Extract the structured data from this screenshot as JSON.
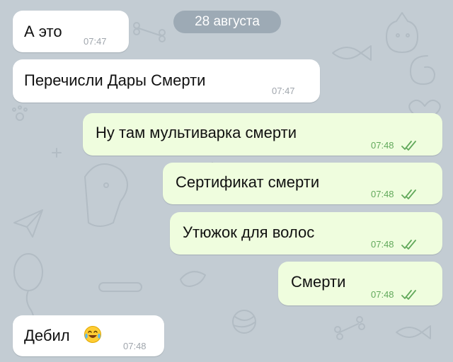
{
  "date_separator": "28 августа",
  "messages": [
    {
      "direction": "in",
      "text": "А это",
      "time": "07:47"
    },
    {
      "direction": "in",
      "text": "Перечисли Дары Смерти",
      "time": "07:47"
    },
    {
      "direction": "out",
      "text": "Ну там мультиварка смерти",
      "time": "07:48",
      "status": "read"
    },
    {
      "direction": "out",
      "text": "Сертификат смерти",
      "time": "07:48",
      "status": "read"
    },
    {
      "direction": "out",
      "text": "Утюжок для волос",
      "time": "07:48",
      "status": "read"
    },
    {
      "direction": "out",
      "text": "Смерти",
      "time": "07:48",
      "status": "read"
    },
    {
      "direction": "in",
      "text": "Дебил",
      "time": "07:48",
      "emoji": "tears-of-joy-emoji"
    }
  ],
  "colors": {
    "wallpaper": "#c3ccd3",
    "incoming_bubble": "#ffffff",
    "outgoing_bubble": "#effdde",
    "outgoing_time": "#62a95b",
    "incoming_time": "#a0a6ad",
    "read_checks": "#62a95b"
  }
}
